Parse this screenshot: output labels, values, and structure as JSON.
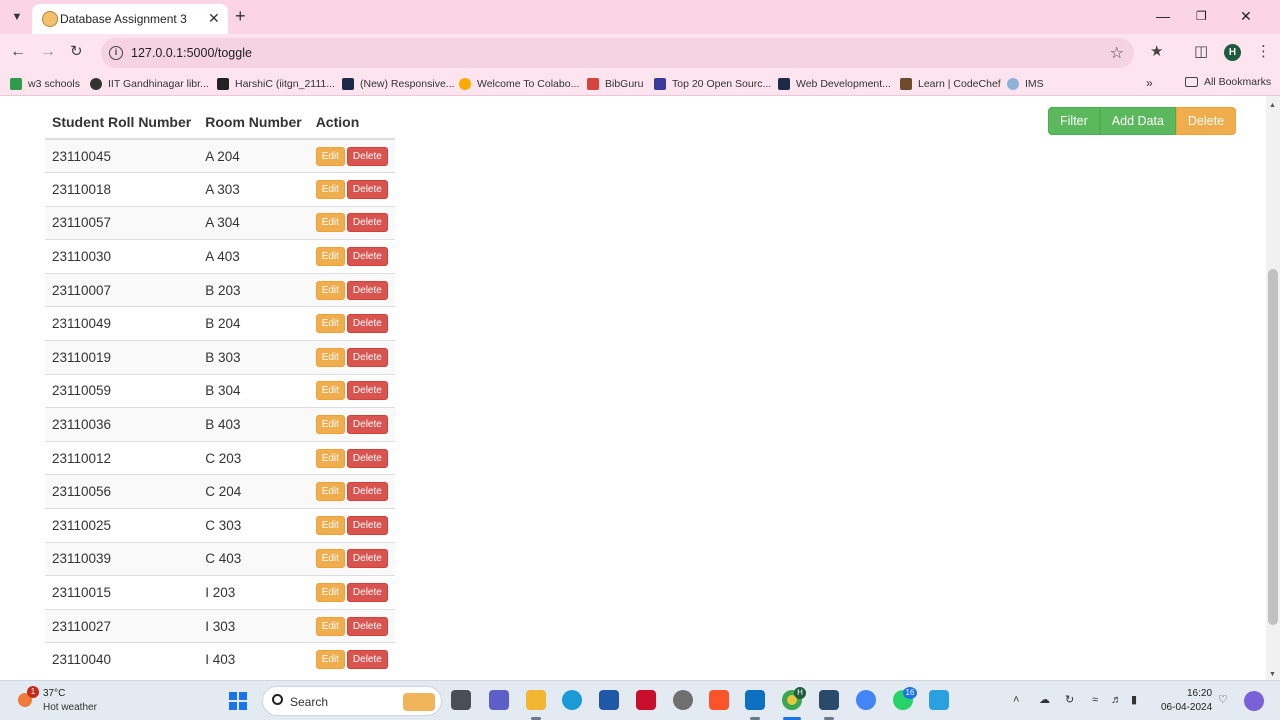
{
  "browser": {
    "tab_title": "Database Assignment 3",
    "url": "127.0.0.1:5000/toggle",
    "profile_initial": "H",
    "bookmarks": [
      "w3 schools",
      "IIT Gandhinagar libr...",
      "HarshiC (iitgn_2111...",
      "(New) Responsive...",
      "Welcome To Colabo...",
      "BibGuru",
      "Top 20 Open Sourc...",
      "Web Development...",
      "Learn | CodeChef",
      "IMS"
    ],
    "all_bookmarks": "All Bookmarks"
  },
  "table": {
    "headers": [
      "Student Roll Number",
      "Room Number",
      "Action"
    ],
    "edit_label": "Edit",
    "delete_label": "Delete",
    "rows": [
      {
        "roll": "23110045",
        "room": "A 204"
      },
      {
        "roll": "23110018",
        "room": "A 303"
      },
      {
        "roll": "23110057",
        "room": "A 304"
      },
      {
        "roll": "23110030",
        "room": "A 403"
      },
      {
        "roll": "23110007",
        "room": "B 203"
      },
      {
        "roll": "23110049",
        "room": "B 204"
      },
      {
        "roll": "23110019",
        "room": "B 303"
      },
      {
        "roll": "23110059",
        "room": "B 304"
      },
      {
        "roll": "23110036",
        "room": "B 403"
      },
      {
        "roll": "23110012",
        "room": "C 203"
      },
      {
        "roll": "23110056",
        "room": "C 204"
      },
      {
        "roll": "23110025",
        "room": "C 303"
      },
      {
        "roll": "23110039",
        "room": "C 403"
      },
      {
        "roll": "23110015",
        "room": "I 203"
      },
      {
        "roll": "23110027",
        "room": "I 303"
      },
      {
        "roll": "23110040",
        "room": "I 403"
      }
    ]
  },
  "actions": {
    "filter": "Filter",
    "add_data": "Add Data",
    "delete": "Delete"
  },
  "taskbar": {
    "weather_badge": "1",
    "temperature": "37°C",
    "condition": "Hot weather",
    "search_placeholder": "Search",
    "chrome_badge": "H",
    "whatsapp_badge": "16",
    "time": "16:20",
    "date": "06-04-2024"
  },
  "colors": {
    "tabstrip": "#fbd5e3",
    "success": "#5cb85c",
    "warning": "#f0ad4e",
    "danger": "#d9534f"
  }
}
